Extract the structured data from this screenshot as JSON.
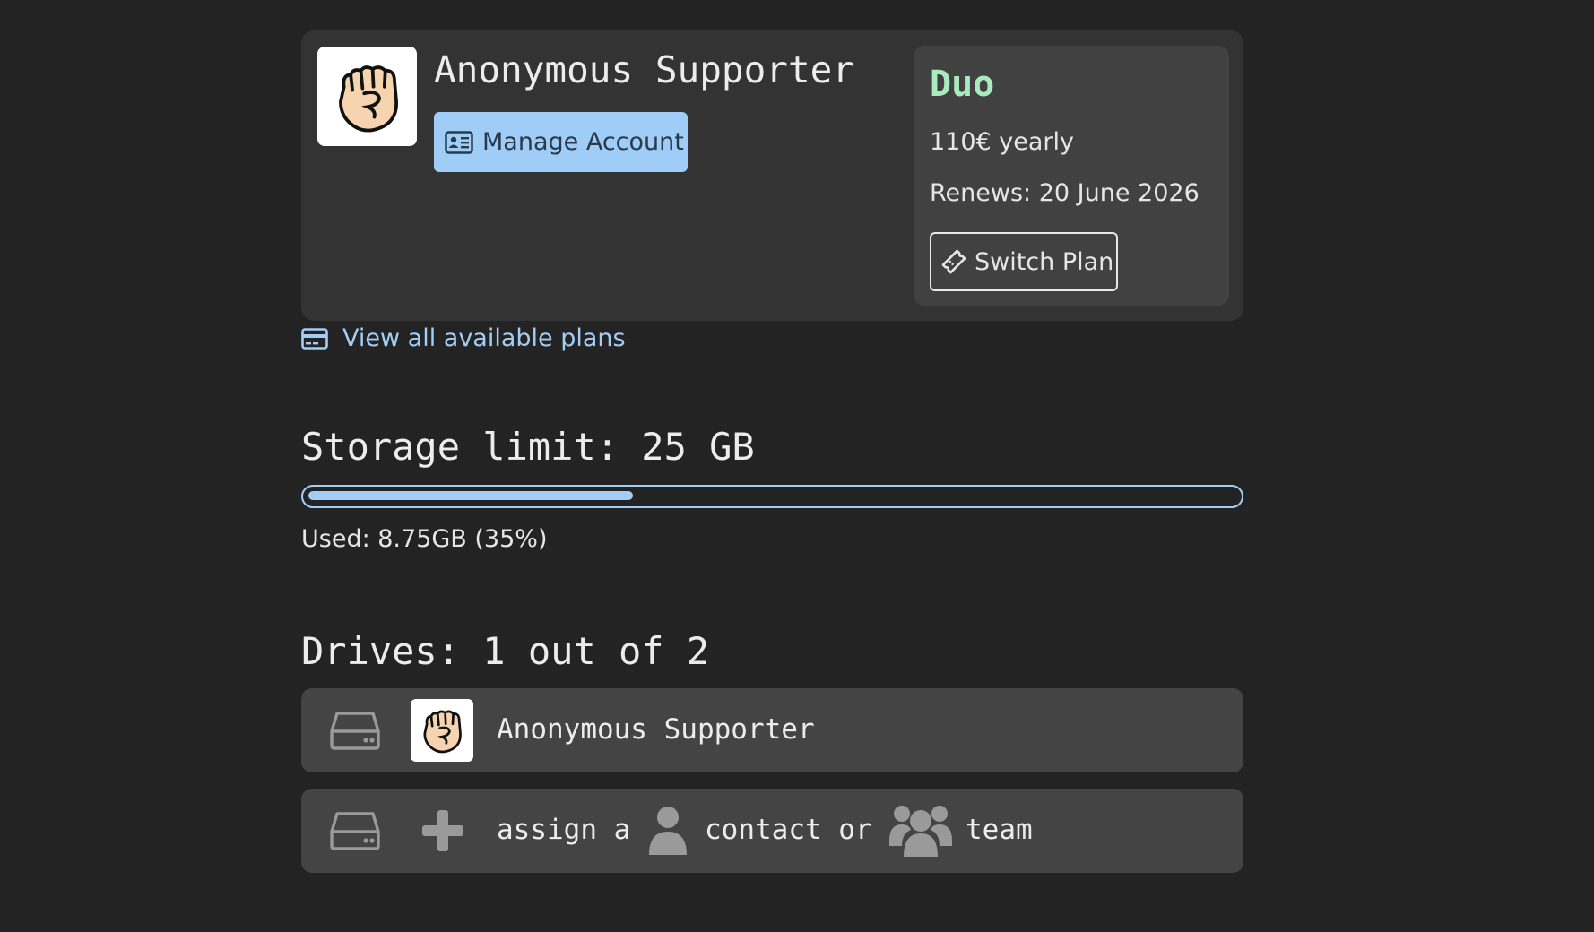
{
  "account": {
    "user_name": "Anonymous Supporter",
    "avatar_icon": "raised-fist-icon",
    "manage_button_label": "Manage Account"
  },
  "plan": {
    "name": "Duo",
    "price": "110€ yearly",
    "renews": "Renews: 20 June 2026",
    "switch_button_label": "Switch Plan"
  },
  "links": {
    "view_plans_label": "View all available plans"
  },
  "storage": {
    "title": "Storage limit: 25 GB",
    "used_label": "Used: 8.75GB (35%)",
    "used_fraction": 0.35
  },
  "drives": {
    "title": "Drives: 1 out of 2",
    "rows": [
      {
        "owner": "Anonymous Supporter"
      },
      {
        "assign_word": "assign a",
        "contact_word": "contact or",
        "team_word": "team"
      }
    ]
  },
  "colors": {
    "background": "#232323",
    "card": "#333333",
    "accent_blue": "#9fcdf7",
    "plan_green": "#a8ecbe",
    "row": "#444444"
  }
}
